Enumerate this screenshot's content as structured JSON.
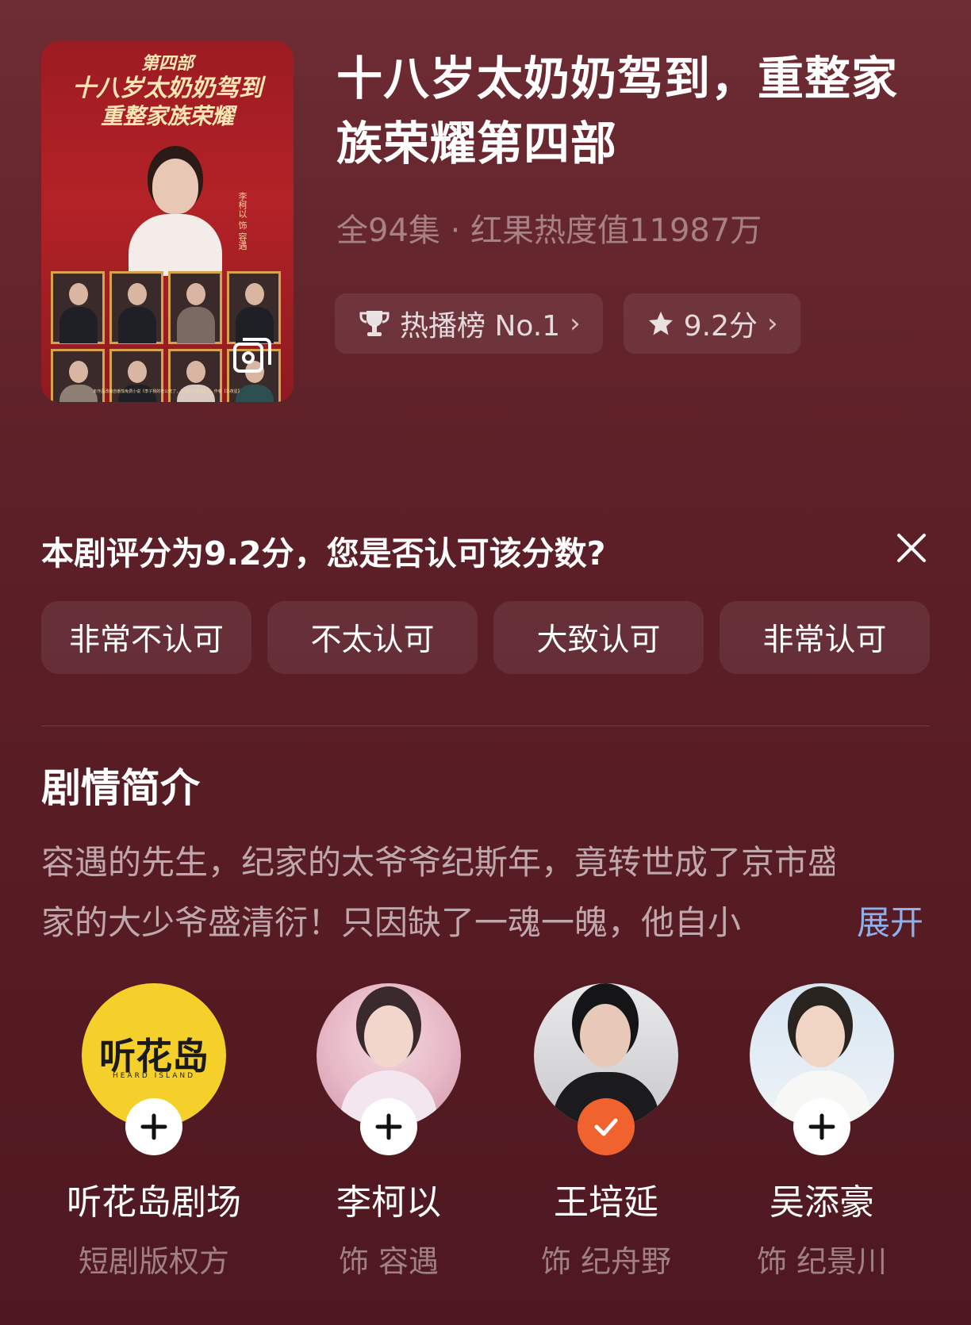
{
  "poster": {
    "title_line1": "第四部",
    "title_line2": "十八岁太奶奶驾到",
    "title_line3": "重整家族荣耀",
    "lead_name": "李柯以 饰 容遇",
    "caption": "本作品改编自番茄免费小说《李子我的老公死了，但我的仨大宝贝》，作者【乌夜星】"
  },
  "drama": {
    "title": "十八岁太奶奶驾到，重整家族荣耀第四部",
    "meta": "全94集 · 红果热度值11987万"
  },
  "badges": {
    "rank_label": "热播榜 No.1",
    "score_label": "9.2分",
    "chevron": "›"
  },
  "rating_survey": {
    "question": "本剧评分为9.2分，您是否认可该分数?",
    "options": [
      "非常不认可",
      "不太认可",
      "大致认可",
      "非常认可"
    ]
  },
  "synopsis": {
    "heading": "剧情简介",
    "line1": "容遇的先生，纪家的太爷爷纪斯年，竟转世成了京市盛",
    "line2": "家的大少爷盛清衍！只因缺了一魂一魄，他自小",
    "expand_label": "展开"
  },
  "cast": [
    {
      "name": "听花岛剧场",
      "role": "短剧版权方",
      "logo_text": "听花岛",
      "logo_sub": "HEARD ISLAND",
      "followed": false
    },
    {
      "name": "李柯以",
      "role": "饰 容遇",
      "followed": false
    },
    {
      "name": "王培延",
      "role": "饰 纪舟野",
      "followed": true
    },
    {
      "name": "吴添豪",
      "role": "饰 纪景川",
      "followed": false
    }
  ],
  "colors": {
    "background": "#5e2028",
    "accent_link": "#8fb0e8",
    "follow_done": "#f0622e",
    "logo_yellow": "#f6d02a"
  },
  "icons": [
    "trophy-icon",
    "star-icon",
    "close-icon",
    "gallery-icon",
    "plus-icon",
    "check-icon"
  ]
}
